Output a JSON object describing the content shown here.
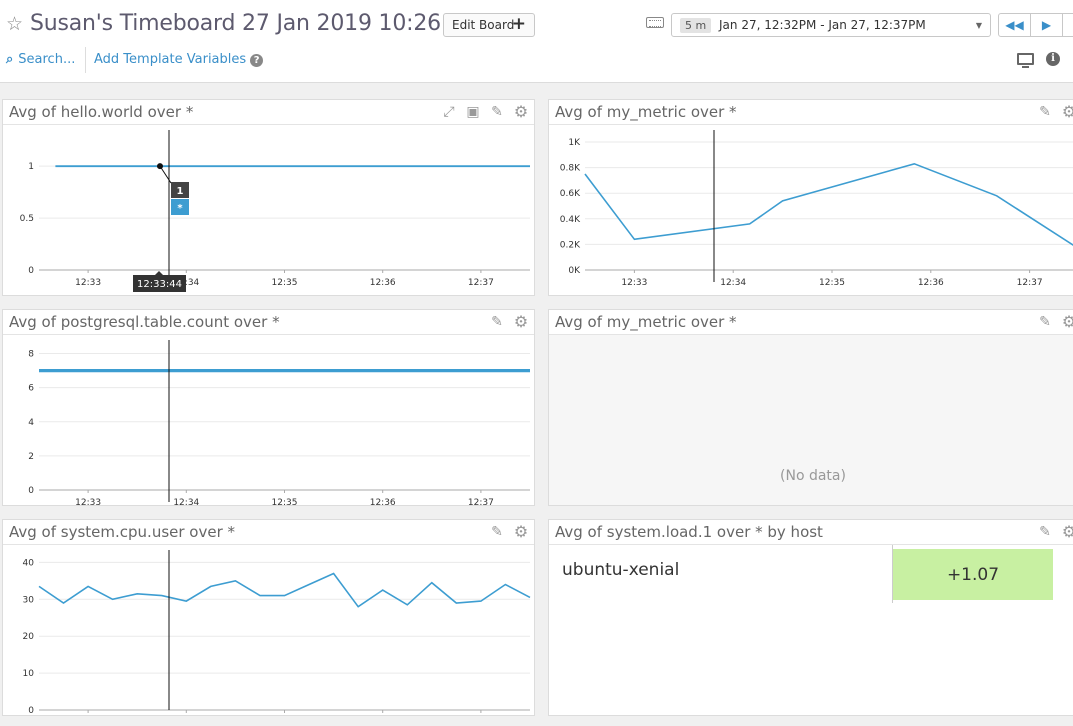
{
  "header": {
    "title": "Susan's Timeboard 27 Jan 2019 10:26",
    "edit_label": "Edit Board",
    "timeframe": {
      "span": "5 m",
      "range": "Jan 27, 12:32PM - Jan 27, 12:37PM"
    },
    "search_label": "Search...",
    "template_label": "Add Template Variables",
    "help_glyph": "?",
    "info_glyph": "i"
  },
  "widgets": {
    "hello_world": {
      "title": "Avg of hello.world over *"
    },
    "my_metric_1": {
      "title": "Avg of my_metric over *"
    },
    "postgres": {
      "title": "Avg of postgresql.table.count over *"
    },
    "my_metric_2": {
      "title": "Avg of my_metric over *",
      "empty_text": "(No data)"
    },
    "cpu_user": {
      "title": "Avg of system.cpu.user over *"
    },
    "system_load": {
      "title": "Avg of system.load.1 over * by host",
      "host": "ubuntu-xenial",
      "value": "+1.07",
      "value_color": "#c8f0a2"
    }
  },
  "chart_data": [
    {
      "type": "line",
      "title": "Avg of hello.world over *",
      "x": [
        "12:32:40",
        "12:33:44",
        "12:37:30"
      ],
      "y": [
        1,
        1,
        1
      ],
      "x_ticks": [
        "12:33",
        "12:34",
        "12:35",
        "12:36",
        "12:37"
      ],
      "y_ticks": [
        "0",
        "0.5",
        "1"
      ],
      "ylim": [
        0,
        1.3
      ],
      "crosshair": {
        "time": "12:33:44",
        "value_label": "1",
        "series_label": "*"
      },
      "color": "#3d9dd1"
    },
    {
      "type": "line",
      "title": "Avg of my_metric over *",
      "x": [
        "12:32:30",
        "12:33:00",
        "12:34:10",
        "12:34:30",
        "12:35:50",
        "12:36:40",
        "12:37:30"
      ],
      "y": [
        750,
        240,
        360,
        540,
        830,
        580,
        165
      ],
      "x_ticks": [
        "12:33",
        "12:34",
        "12:35",
        "12:36",
        "12:37"
      ],
      "y_ticks": [
        "0K",
        "0.2K",
        "0.4K",
        "0.6K",
        "0.8K",
        "1K"
      ],
      "ylim": [
        0,
        1000
      ],
      "color": "#3d9dd1"
    },
    {
      "type": "line",
      "title": "Avg of postgresql.table.count over *",
      "x": [
        "12:32:30",
        "12:37:30"
      ],
      "y": [
        7,
        7
      ],
      "x_ticks": [
        "12:33",
        "12:34",
        "12:35",
        "12:36",
        "12:37"
      ],
      "y_ticks": [
        "0",
        "2",
        "4",
        "6",
        "8"
      ],
      "ylim": [
        0,
        8.5
      ],
      "color": "#3d9dd1"
    },
    {
      "type": "line",
      "title": "Avg of system.cpu.user over *",
      "x": [
        "12:32:30",
        "12:32:40",
        "12:32:50",
        "12:33:00",
        "12:33:10",
        "12:33:20",
        "12:33:30",
        "12:33:40",
        "12:33:50",
        "12:34:00",
        "12:34:10",
        "12:34:20",
        "12:34:30",
        "12:34:40",
        "12:34:50",
        "12:35:00",
        "12:35:10",
        "12:35:20",
        "12:35:30",
        "12:35:40",
        "12:35:50",
        "12:36:00",
        "12:36:10",
        "12:36:20",
        "12:36:30",
        "12:36:40",
        "12:36:50",
        "12:37:00",
        "12:37:10",
        "12:37:20",
        "12:37:30"
      ],
      "y": [
        33.5,
        29,
        33.5,
        30,
        31.5,
        31,
        29.5,
        33.5,
        35,
        31,
        31,
        34,
        37,
        28,
        32.5,
        28.5,
        34.5,
        29,
        29.5,
        34,
        30.5
      ],
      "x_ticks": [
        "12:33",
        "12:34",
        "12:35",
        "12:36",
        "12:37"
      ],
      "y_ticks": [
        "0",
        "10",
        "20",
        "30",
        "40"
      ],
      "ylim": [
        0,
        42
      ],
      "color": "#3d9dd1"
    }
  ]
}
